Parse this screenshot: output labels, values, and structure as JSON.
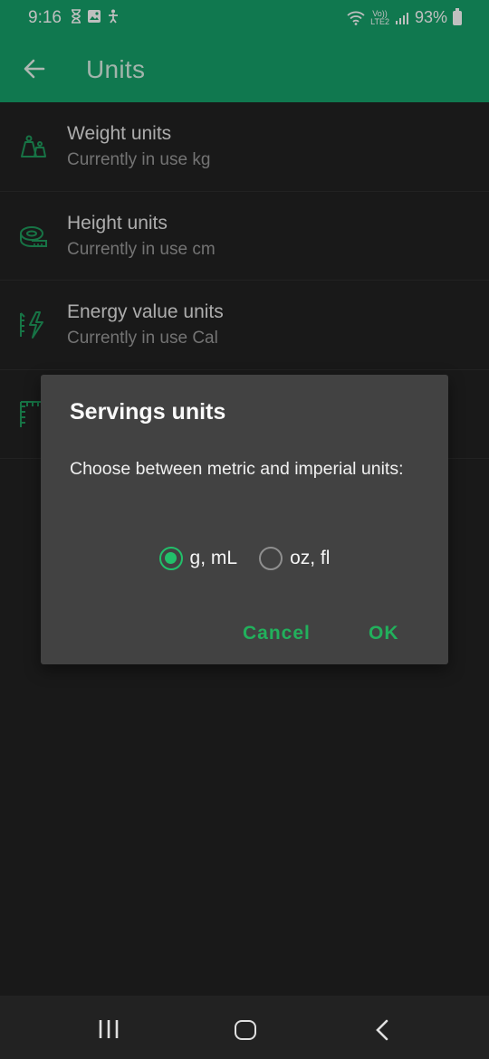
{
  "status_bar": {
    "time": "9:16",
    "battery": "93%",
    "network_top": "Vo))",
    "network_bottom": "LTE2"
  },
  "app_bar": {
    "title": "Units",
    "color": "#16a06a"
  },
  "list": {
    "items": [
      {
        "title": "Weight units",
        "subtitle": "Currently in use kg",
        "icon": "weight-icon"
      },
      {
        "title": "Height units",
        "subtitle": "Currently in use cm",
        "icon": "tape-measure-icon"
      },
      {
        "title": "Energy value units",
        "subtitle": "Currently in use Cal",
        "icon": "energy-icon"
      },
      {
        "title": "",
        "subtitle": "",
        "icon": "ruler-icon"
      }
    ]
  },
  "dialog": {
    "title": "Servings units",
    "message": "Choose between metric and imperial units:",
    "options": [
      {
        "label": "g, mL",
        "selected": true
      },
      {
        "label": "oz, fl",
        "selected": false
      }
    ],
    "cancel_label": "Cancel",
    "ok_label": "OK",
    "accent": "#22b05c"
  }
}
